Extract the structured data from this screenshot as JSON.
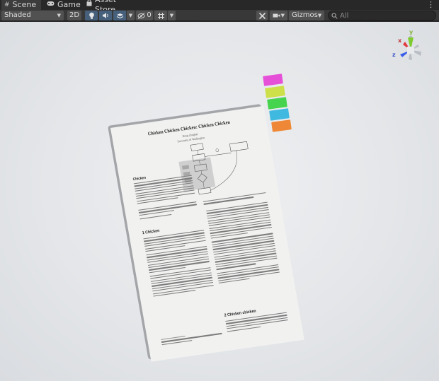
{
  "tabs": [
    {
      "label": "Scene",
      "icon": "hash-icon",
      "active": true
    },
    {
      "label": "Game",
      "icon": "gamepad-icon",
      "active": false
    },
    {
      "label": "Asset Store",
      "icon": "shopping-bag-icon",
      "active": false
    }
  ],
  "toolbar": {
    "shading_mode": "Shaded",
    "mode_2d": "2D",
    "hidden_count": "0",
    "gizmos_label": "Gizmos",
    "search_placeholder": "All"
  },
  "scene": {
    "background": "#e4e6e9",
    "paper": {
      "title": "Chicken Chicken Chicken: Chicken Chicken",
      "author": "Doug Zongker",
      "affiliation": "University of Washington",
      "abstract_heading": "Chicken",
      "section1_heading": "1   Chicken",
      "section2_heading": "2   Chicken chicken",
      "sticky_tab_colors": [
        "#e64fd8",
        "#cde04a",
        "#46d44f",
        "#3fb9e0",
        "#ee8736"
      ]
    },
    "gizmo_axes": {
      "x": "x",
      "y": "y",
      "z": "z"
    }
  },
  "colors": {
    "toolbar_bg": "#383838",
    "tab_bg": "#282828",
    "active_tab_bg": "#3c3c3c",
    "button_bg": "#515151",
    "toggle_on_bg": "#46607c"
  }
}
